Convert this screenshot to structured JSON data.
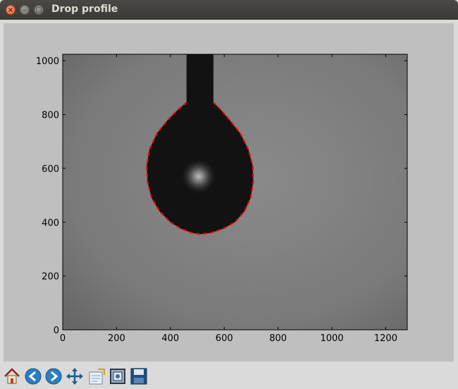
{
  "window": {
    "title": "Drop profile",
    "close_glyph": "×",
    "minimize_glyph": "–",
    "maximize_glyph": "□"
  },
  "chart_data": {
    "type": "scatter",
    "title": "",
    "xlabel": "",
    "ylabel": "",
    "xlim": [
      0,
      1280
    ],
    "ylim": [
      0,
      1024
    ],
    "x_ticks": [
      0,
      200,
      400,
      600,
      800,
      1000,
      1200
    ],
    "y_ticks": [
      0,
      200,
      400,
      600,
      800,
      1000
    ],
    "grid": false,
    "background": "grayscale image of a pendant drop hanging from a needle",
    "series": [
      {
        "style": "dashed",
        "color": "#ff0000",
        "x": [
          460,
          430,
          390,
          350,
          322,
          312,
          315,
          330,
          360,
          400,
          440,
          480,
          510,
          550,
          595,
          640,
          675,
          698,
          708,
          706,
          690,
          660,
          620,
          585,
          560
        ],
        "y": [
          845,
          820,
          780,
          730,
          670,
          610,
          550,
          490,
          440,
          400,
          375,
          360,
          355,
          360,
          375,
          400,
          440,
          490,
          550,
          610,
          670,
          730,
          780,
          820,
          845
        ]
      }
    ]
  },
  "toolbar": {
    "tools": [
      "home-icon",
      "back-arrow-icon",
      "forward-arrow-icon",
      "pan-move-icon",
      "configure-subplots-icon",
      "zoom-rect-icon",
      "save-disk-icon"
    ]
  }
}
